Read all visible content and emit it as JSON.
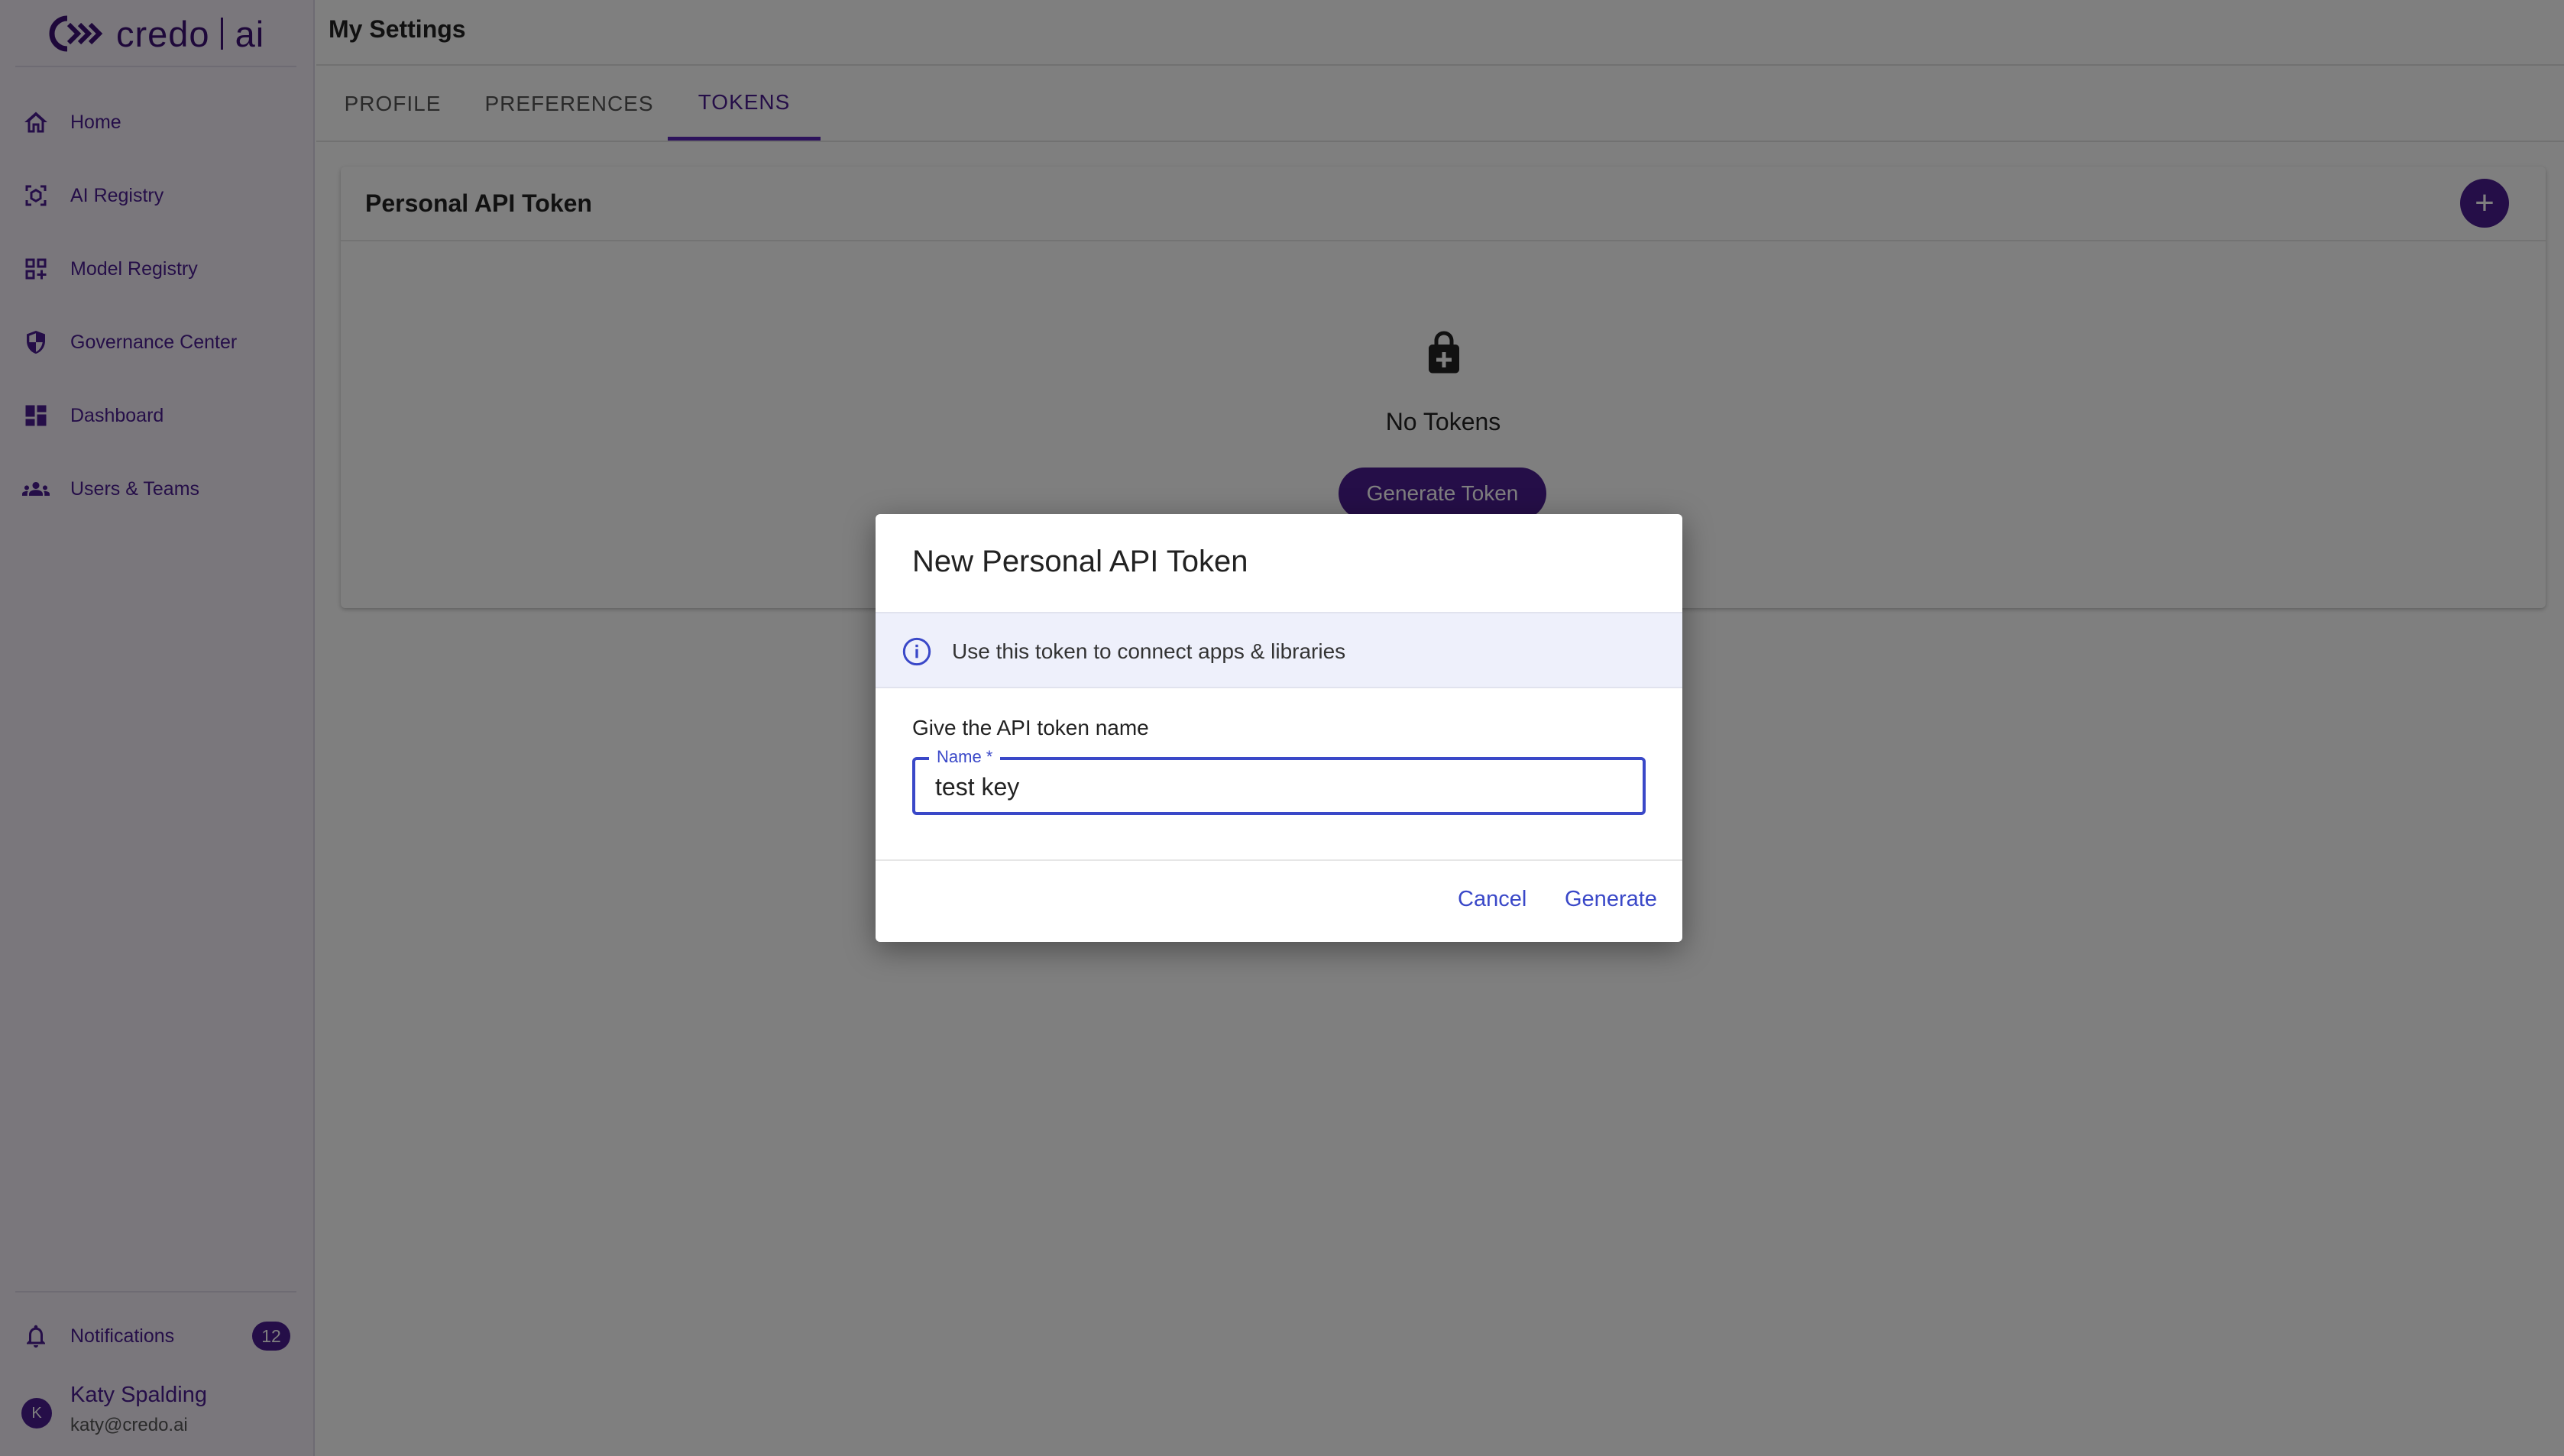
{
  "brand": {
    "name_left": "credo",
    "name_right": "ai"
  },
  "sidebar": {
    "items": [
      {
        "label": "Home",
        "icon": "home-icon"
      },
      {
        "label": "AI Registry",
        "icon": "ai-registry-icon"
      },
      {
        "label": "Model Registry",
        "icon": "model-registry-icon"
      },
      {
        "label": "Governance Center",
        "icon": "shield-icon"
      },
      {
        "label": "Dashboard",
        "icon": "dashboard-icon"
      },
      {
        "label": "Users & Teams",
        "icon": "users-icon"
      }
    ],
    "notifications": {
      "label": "Notifications",
      "count": "12",
      "icon": "bell-icon"
    },
    "user": {
      "initial": "K",
      "name": "Katy Spalding",
      "email": "katy@credo.ai"
    }
  },
  "header": {
    "title": "My Settings"
  },
  "tabs": [
    {
      "label": "PROFILE",
      "active": false
    },
    {
      "label": "PREFERENCES",
      "active": false
    },
    {
      "label": "TOKENS",
      "active": true
    }
  ],
  "card": {
    "title": "Personal API Token",
    "empty_text": "No Tokens",
    "generate_button": "Generate Token"
  },
  "dialog": {
    "title": "New Personal API Token",
    "info": "Use this token to connect apps & libraries",
    "prompt": "Give the API token name",
    "field_label": "Name *",
    "field_value": "test key",
    "cancel": "Cancel",
    "generate": "Generate"
  },
  "colors": {
    "accent": "#4a1c91",
    "link": "#3a48c8",
    "sidebar_bg": "#f4eff9"
  }
}
